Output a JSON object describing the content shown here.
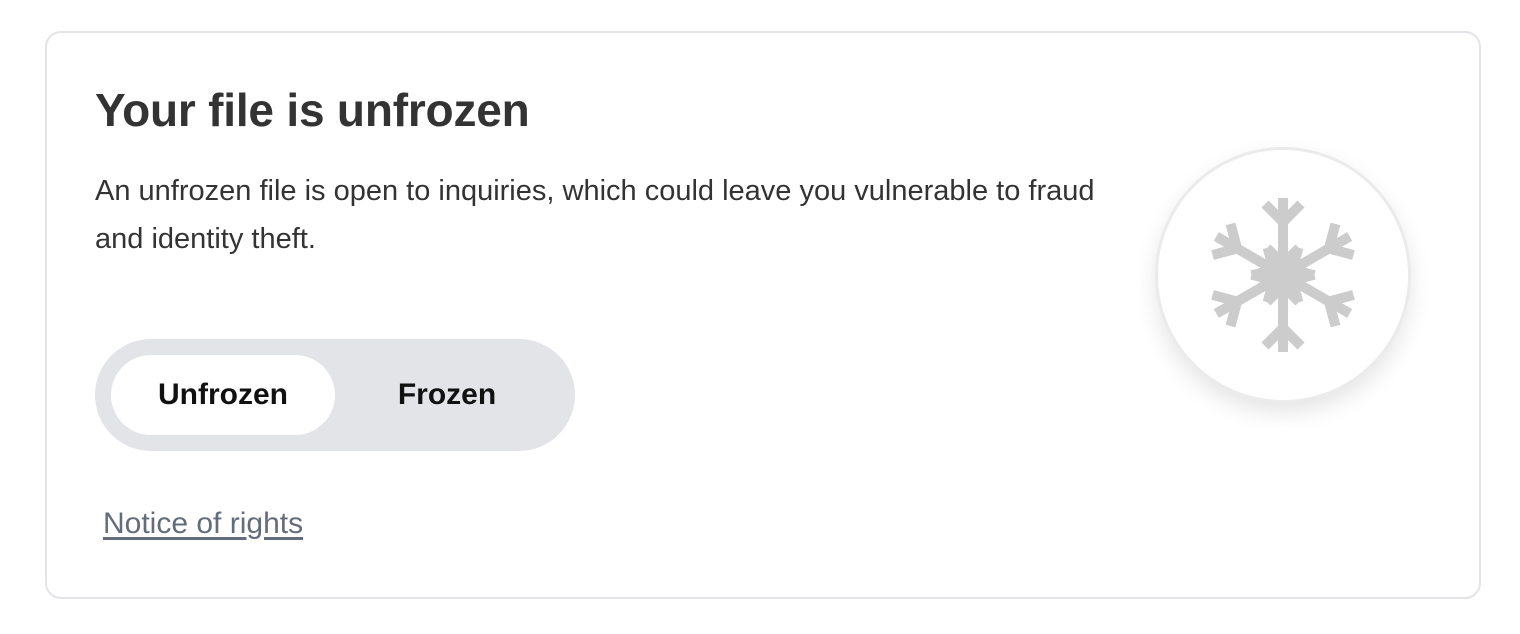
{
  "card": {
    "title": "Your file is unfrozen",
    "description": "An unfrozen file is open to inquiries, which could leave you vulnerable to fraud and identity theft.",
    "toggle": {
      "options": [
        {
          "label": "Unfrozen",
          "selected": true
        },
        {
          "label": "Frozen",
          "selected": false
        }
      ]
    },
    "notice_link": "Notice of rights",
    "status_icon": "snowflake-icon"
  },
  "colors": {
    "title_text": "#333333",
    "toggle_track": "#e3e4e8",
    "toggle_selected": "#ffffff",
    "link": "#646c7b",
    "icon": "#cccccc"
  }
}
